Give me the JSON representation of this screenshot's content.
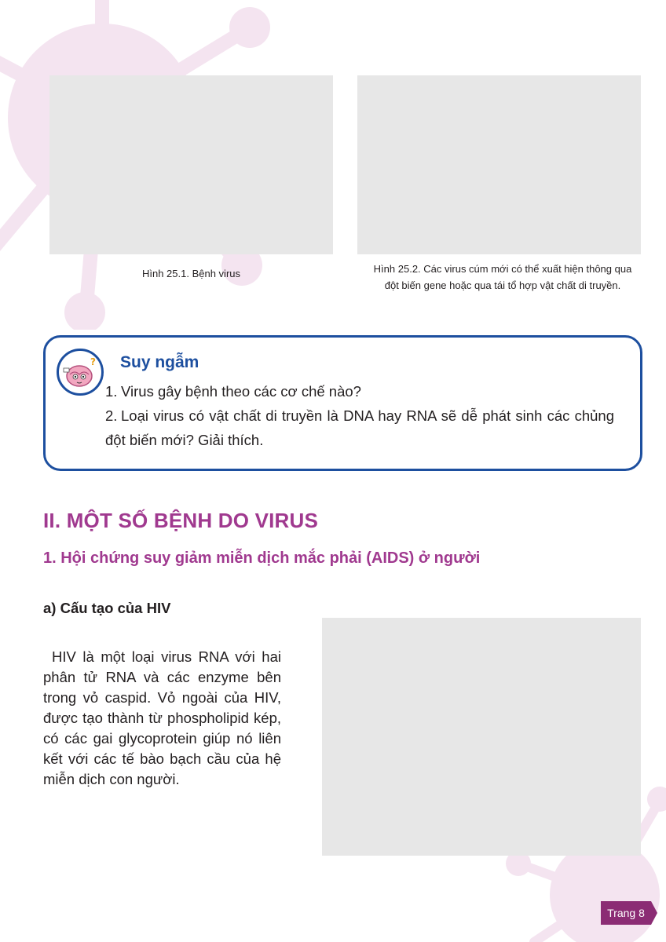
{
  "figures": {
    "fig1_caption": "Hình 25.1. Bệnh virus",
    "fig2_caption_line1": "Hình 25.2. Các virus cúm mới có thể xuất hiện thông qua",
    "fig2_caption_line2": "đột biến gene hoặc qua tái tổ hợp vật chất di truyền.",
    "fig3_caption": ""
  },
  "reflection": {
    "title": "Suy ngẫm",
    "questions": [
      {
        "num": "1.",
        "text": "Virus gây bệnh theo các cơ chế nào?"
      },
      {
        "num": "2.",
        "text": "Loại virus có vật chất di truyền là DNA hay RNA sẽ dễ phát sinh các chủng đột biến mới? Giải thích."
      }
    ]
  },
  "section": {
    "heading": "II. MỘT SỐ BỆNH DO VIRUS",
    "subheading": "1. Hội chứng suy giảm miễn dịch mắc phải (AIDS) ở người",
    "subsubheading": "a) Cấu tạo của HIV",
    "paragraph": "HIV là một loại virus RNA với hai phân tử RNA và các enzyme bên trong vỏ caspid. Vỏ ngoài của HIV, được tạo thành từ phospholipid kép, có các gai glycoprotein giúp nó liên kết với các tế bào bạch cầu của hệ miễn dịch con người."
  },
  "footer": {
    "page_label": "Trang 8"
  },
  "colors": {
    "accent_purple": "#a0398f",
    "box_blue": "#1d4f9f",
    "page_tag": "#8b2c74",
    "virus_bg": "#f3e3ef",
    "placeholder": "#e7e7e7"
  }
}
